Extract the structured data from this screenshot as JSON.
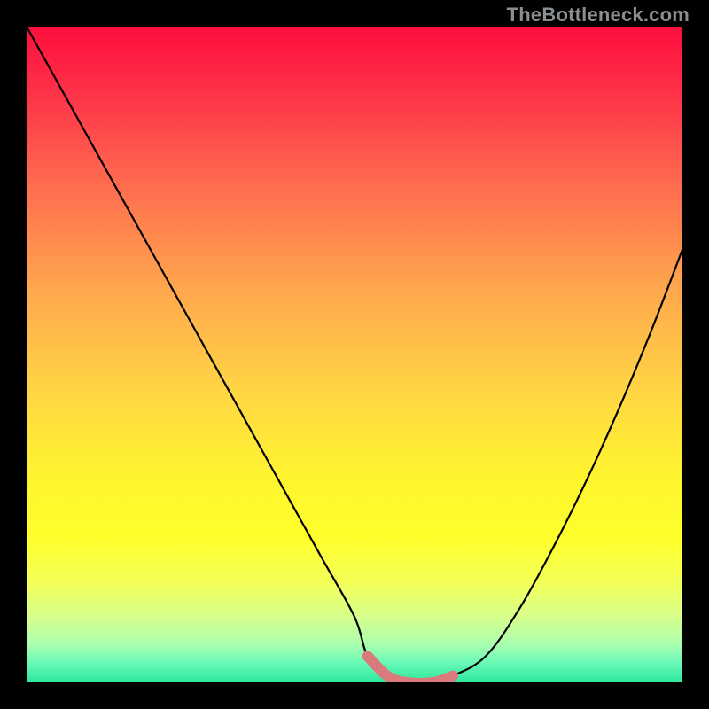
{
  "watermark": "TheBottleneck.com",
  "chart_data": {
    "type": "line",
    "title": "",
    "xlabel": "",
    "ylabel": "",
    "xlim": [
      0,
      100
    ],
    "ylim": [
      0,
      100
    ],
    "grid": false,
    "legend": false,
    "series": [
      {
        "name": "curve",
        "color": "#000000",
        "x": [
          0,
          5,
          10,
          15,
          20,
          25,
          30,
          35,
          40,
          45,
          50,
          52,
          55,
          58,
          62,
          65,
          70,
          75,
          80,
          85,
          90,
          95,
          100
        ],
        "y": [
          100,
          91,
          82,
          73,
          64,
          55,
          46,
          37,
          28,
          19,
          10,
          4,
          1,
          0,
          0,
          1,
          4,
          11,
          20,
          30,
          41,
          53,
          66
        ]
      }
    ],
    "highlight": {
      "name": "bottom-plateau",
      "color": "#d97b7d",
      "x": [
        52,
        55,
        58,
        62,
        65
      ],
      "y": [
        4,
        1,
        0,
        0,
        1
      ]
    },
    "background_gradient": {
      "stops": [
        {
          "pos": 0.0,
          "color": "#fd0d3d"
        },
        {
          "pos": 0.1,
          "color": "#fe3148"
        },
        {
          "pos": 0.25,
          "color": "#ff6f4f"
        },
        {
          "pos": 0.4,
          "color": "#ffa74e"
        },
        {
          "pos": 0.55,
          "color": "#ffd444"
        },
        {
          "pos": 0.68,
          "color": "#fff330"
        },
        {
          "pos": 0.78,
          "color": "#feff2a"
        },
        {
          "pos": 0.85,
          "color": "#f2ff5a"
        },
        {
          "pos": 0.9,
          "color": "#d7ff8c"
        },
        {
          "pos": 0.94,
          "color": "#acffae"
        },
        {
          "pos": 0.97,
          "color": "#6bf9b8"
        },
        {
          "pos": 1.0,
          "color": "#2ce89b"
        }
      ]
    }
  }
}
